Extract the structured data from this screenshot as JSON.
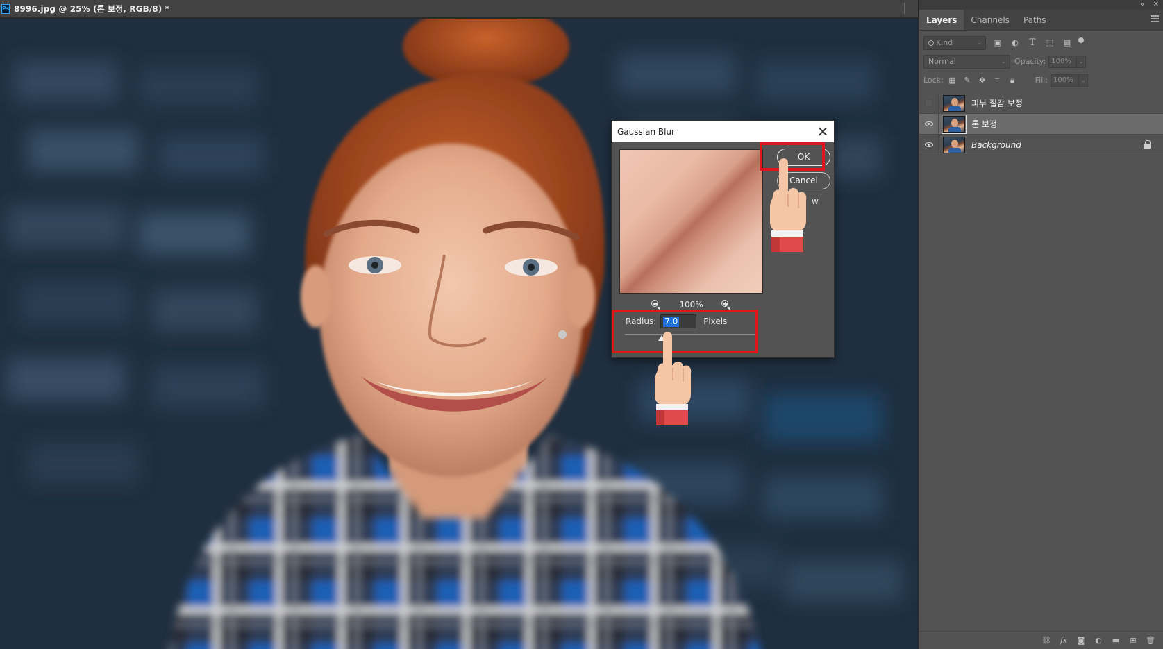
{
  "document": {
    "app_badge": "Ps",
    "tab_title": "8996.jpg @ 25% (톤 보정, RGB/8) *"
  },
  "layers_panel": {
    "tabs": [
      {
        "label": "Layers",
        "active": true
      },
      {
        "label": "Channels",
        "active": false
      },
      {
        "label": "Paths",
        "active": false
      }
    ],
    "filter_kind": "Kind",
    "blend_mode": "Normal",
    "opacity_label": "Opacity:",
    "opacity_value": "100%",
    "lock_label": "Lock:",
    "fill_label": "Fill:",
    "fill_value": "100%",
    "layers": [
      {
        "name": "피부 질감 보정",
        "visible": false,
        "selected": false,
        "locked": false,
        "italic": false
      },
      {
        "name": "톤 보정",
        "visible": true,
        "selected": true,
        "locked": false,
        "italic": false
      },
      {
        "name": "Background",
        "visible": true,
        "selected": false,
        "locked": true,
        "italic": true
      }
    ],
    "footer_icons": [
      "link-icon",
      "fx-icon",
      "mask-icon",
      "adjustment-icon",
      "folder-icon",
      "new-layer-icon",
      "trash-icon"
    ]
  },
  "dialog": {
    "title": "Gaussian Blur",
    "ok_label": "OK",
    "cancel_label": "Cancel",
    "preview_label": "w",
    "zoom_level": "100%",
    "radius_label": "Radius:",
    "radius_value": "7.0",
    "radius_unit": "Pixels",
    "radius_slider_fraction": 0.28
  },
  "colors": {
    "highlight": "#e0131f",
    "selection": "#1e6fd9",
    "panel_bg": "#535353"
  }
}
